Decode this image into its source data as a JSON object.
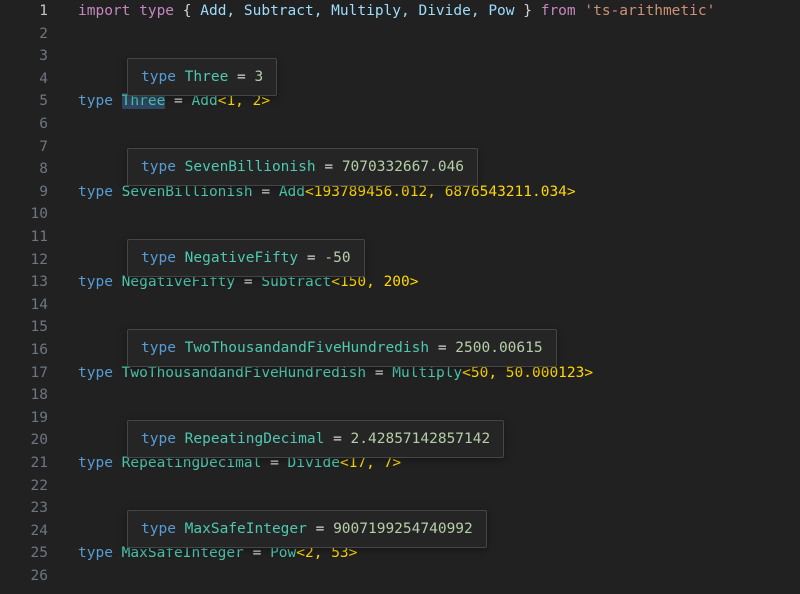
{
  "editor": {
    "language": "typescript",
    "background_color": "#212121",
    "total_lines": 26,
    "active_line": 1,
    "gutter": {
      "line_numbers": [
        "1",
        "2",
        "3",
        "4",
        "5",
        "6",
        "7",
        "8",
        "9",
        "10",
        "11",
        "12",
        "13",
        "14",
        "15",
        "16",
        "17",
        "18",
        "19",
        "20",
        "21",
        "22",
        "23",
        "24",
        "25",
        "26"
      ]
    },
    "theme_colors": {
      "background": "#212121",
      "tooltip_background": "#252526",
      "tooltip_border": "#454545",
      "line_number": "#6e7681",
      "active_line_number": "#c6c6c6",
      "keyword_pink": "#c586c0",
      "keyword_blue": "#569cd6",
      "identifier_light_blue": "#9cdcfe",
      "type_teal": "#4ec9b0",
      "string_orange": "#ce9178",
      "number_green": "#b5cea8",
      "punctuation": "#d4d4d4",
      "angle_bracket_yellow": "#ffd700",
      "word_highlight": "#2f4662",
      "hover_underline": "#4a7ebb"
    }
  },
  "code": {
    "line1": {
      "import_kw": "import type",
      "brace_open": " { ",
      "names": "Add, Subtract, Multiply, Divide, Pow",
      "brace_close": " } ",
      "from_kw": "from",
      "module": " 'ts-arithmetic'"
    },
    "line5": {
      "type_kw": "type ",
      "name": "Three",
      "equals": " = ",
      "util": "Add",
      "args": "<1, 2>"
    },
    "line9": {
      "type_kw": "type ",
      "name": "SevenBillionish",
      "equals": " = ",
      "util": "Add",
      "args": "<193789456.012, 6876543211.034>"
    },
    "line13": {
      "type_kw": "type ",
      "name": "NegativeFifty",
      "equals": " = ",
      "util": "Subtract",
      "args": "<150, 200>"
    },
    "line17": {
      "type_kw": "type ",
      "name": "TwoThousandandFiveHundredish",
      "equals": " = ",
      "util": "Multiply",
      "args": "<50, 50.000123>"
    },
    "line21": {
      "type_kw": "type ",
      "name": "RepeatingDecimal",
      "equals": " = ",
      "util": "Divide",
      "args": "<17, 7>"
    },
    "line25": {
      "type_kw": "type ",
      "name": "MaxSafeInteger",
      "equals": " = ",
      "util": "Pow",
      "args": "<2, 53>"
    }
  },
  "tooltips": [
    {
      "id": "three",
      "type_kw": "type ",
      "name": "Three",
      "equals": " = ",
      "value": "3"
    },
    {
      "id": "sevenbillionish",
      "type_kw": "type ",
      "name": "SevenBillionish",
      "equals": " = ",
      "value": "7070332667.046"
    },
    {
      "id": "negativefifty",
      "type_kw": "type ",
      "name": "NegativeFifty",
      "equals": " = ",
      "value": "-50"
    },
    {
      "id": "twothousandandfivehundredish",
      "type_kw": "type ",
      "name": "TwoThousandandFiveHundredish",
      "equals": " = ",
      "value": "2500.00615"
    },
    {
      "id": "repeatingdecimal",
      "type_kw": "type ",
      "name": "RepeatingDecimal",
      "equals": " = ",
      "value": "2.42857142857142"
    },
    {
      "id": "maxsafeinteger",
      "type_kw": "type ",
      "name": "MaxSafeInteger",
      "equals": " = ",
      "value": "9007199254740992"
    }
  ]
}
